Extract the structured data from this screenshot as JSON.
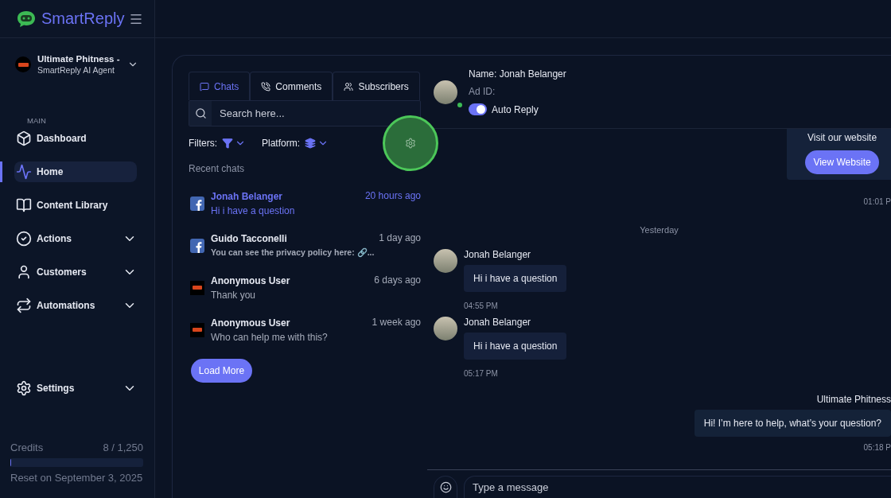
{
  "brand": {
    "name": "SmartReply"
  },
  "account": {
    "name": "Ultimate Phitness -",
    "subtitle": "SmartReply AI Agent"
  },
  "sidebar": {
    "section": "MAIN",
    "items": [
      {
        "label": "Dashboard",
        "selected": false,
        "expandable": false
      },
      {
        "label": "Home",
        "selected": true,
        "expandable": false
      },
      {
        "label": "Content Library",
        "selected": false,
        "expandable": false
      },
      {
        "label": "Actions",
        "selected": false,
        "expandable": true
      },
      {
        "label": "Customers",
        "selected": false,
        "expandable": true
      },
      {
        "label": "Automations",
        "selected": false,
        "expandable": true
      }
    ],
    "settings": {
      "label": "Settings",
      "expandable": true
    }
  },
  "credits": {
    "label": "Credits",
    "value": "8 / 1,250",
    "level": 0.0064,
    "reset": "Reset on September 3, 2025"
  },
  "tabs": [
    {
      "label": "Chats",
      "selected": true
    },
    {
      "label": "Comments",
      "selected": false
    },
    {
      "label": "Subscribers",
      "selected": false
    }
  ],
  "search": {
    "placeholder": "Search here..."
  },
  "filters": {
    "filters_label": "Filters:",
    "platform_label": "Platform:"
  },
  "recent_label": "Recent chats",
  "chats": [
    {
      "name": "Jonah Belanger",
      "preview": "Hi i have a question",
      "time": "20 hours ago",
      "kind": "facebook",
      "selected": true,
      "bold_preview": false
    },
    {
      "name": "Guido Tacconelli",
      "preview": "You can see the privacy policy here: 🔗...",
      "time": "1 day ago",
      "kind": "facebook",
      "selected": false,
      "bold_preview": true
    },
    {
      "name": "Anonymous User",
      "preview": "Thank you",
      "time": "6 days ago",
      "kind": "brand",
      "selected": false,
      "bold_preview": false
    },
    {
      "name": "Anonymous User",
      "preview": "Who can help me with this?",
      "time": "1 week ago",
      "kind": "brand",
      "selected": false,
      "bold_preview": false
    }
  ],
  "load_more": "Load More",
  "contact": {
    "name": "Name: Jonah Belanger",
    "ad_id": "Ad ID:",
    "online": true,
    "auto_reply": {
      "label": "Auto Reply",
      "on": true
    }
  },
  "messages": [
    {
      "kind": "card",
      "text": "Visit our website",
      "button": "View Website",
      "time": "01:01 P"
    },
    {
      "kind": "divider",
      "text": "Yesterday"
    },
    {
      "kind": "incoming",
      "sender": "Jonah Belanger",
      "text": "Hi i have a question",
      "time": "04:55 PM"
    },
    {
      "kind": "incoming",
      "sender": "Jonah Belanger",
      "text": "Hi i have a question",
      "time": "05:17 PM"
    },
    {
      "kind": "outgoing",
      "sender": "Ultimate Phitness",
      "text": "Hi! I’m here to help, what’s your question?",
      "time": "05:18 P"
    }
  ],
  "composer": {
    "placeholder": "Type a message"
  }
}
